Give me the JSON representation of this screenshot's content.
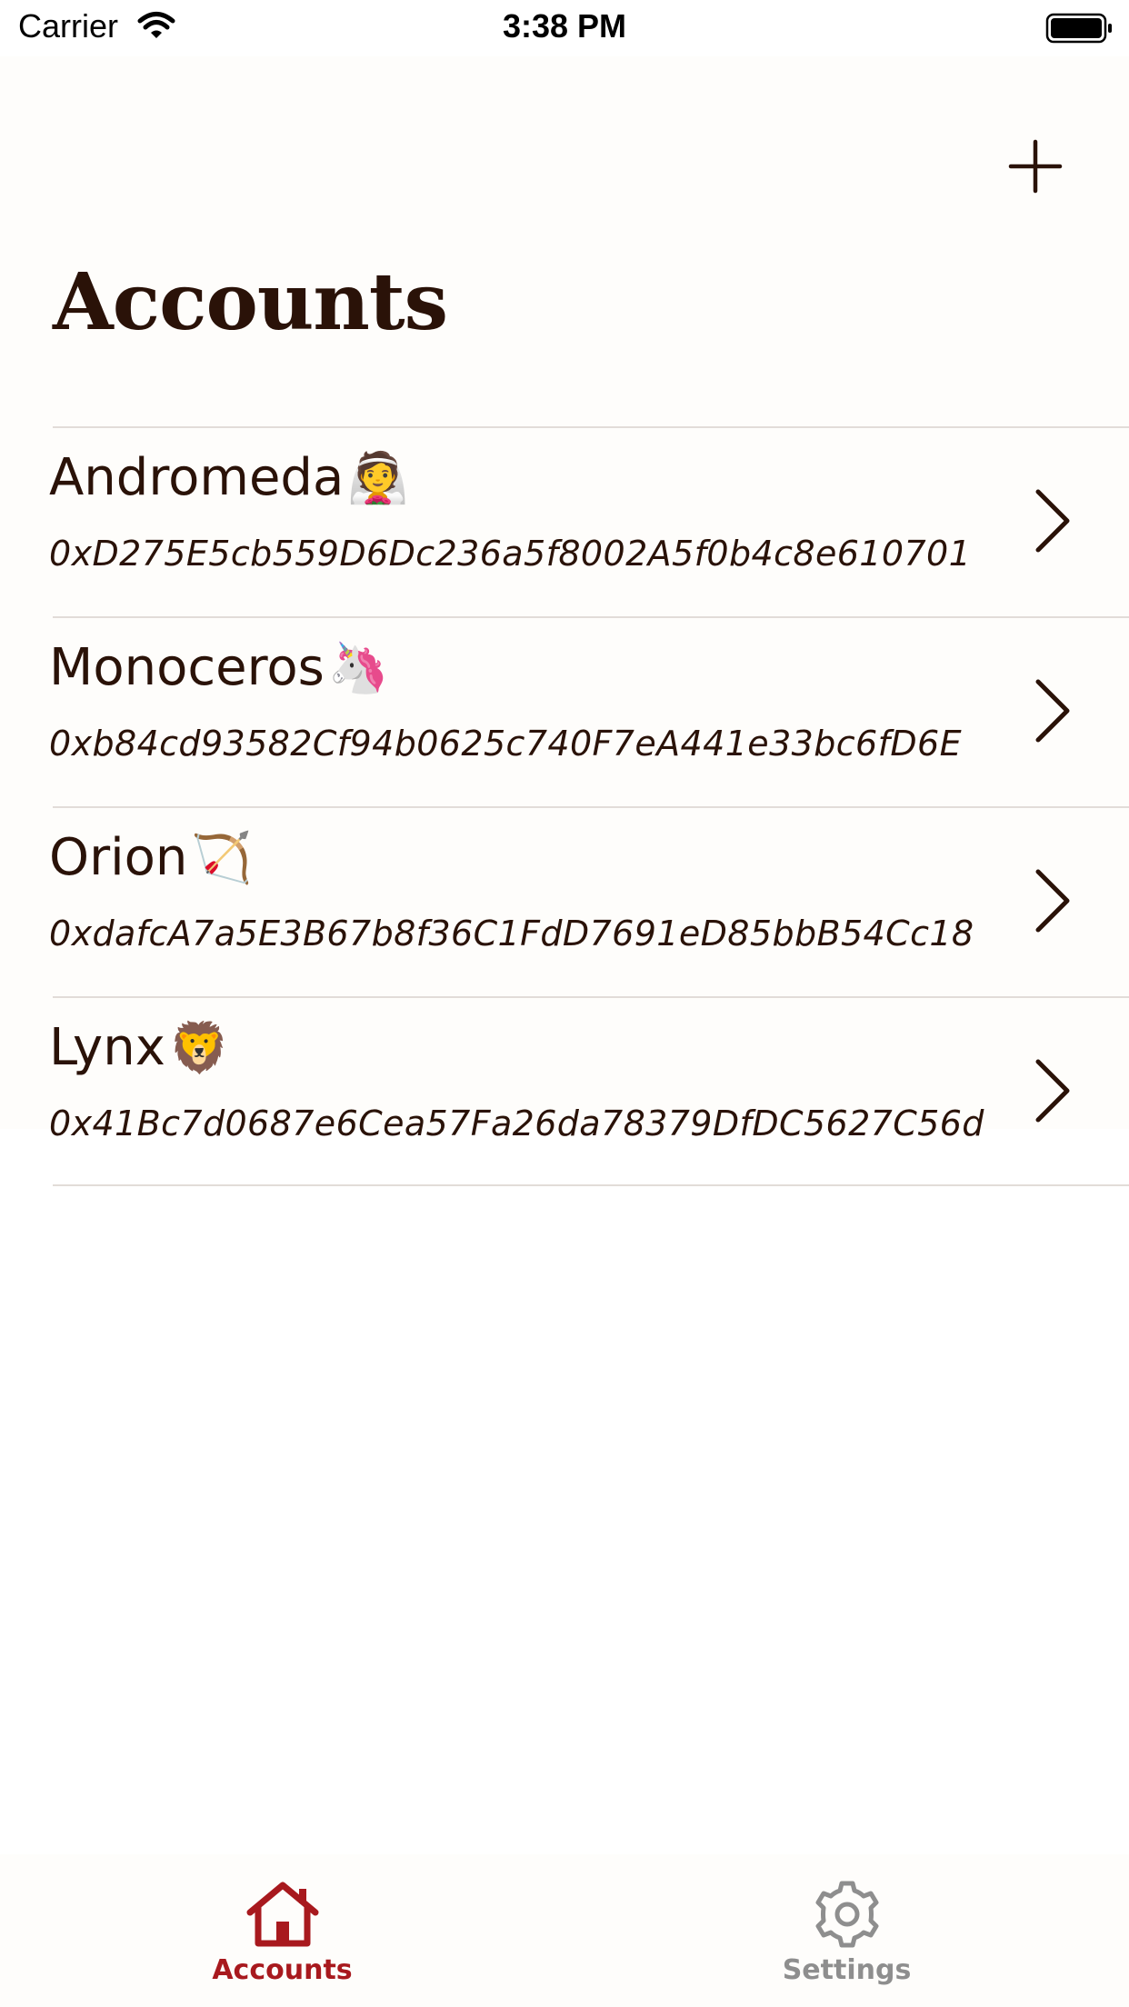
{
  "status_bar": {
    "carrier": "Carrier",
    "time": "3:38 PM"
  },
  "header": {
    "title": "Accounts",
    "add_icon": "plus-icon"
  },
  "accounts": [
    {
      "name": "Andromeda",
      "emoji": "👰",
      "address": "0xD275E5cb559D6Dc236a5f8002A5f0b4c8e610701"
    },
    {
      "name": "Monoceros",
      "emoji": "🦄",
      "address": "0xb84cd93582Cf94b0625c740F7eA441e33bc6fD6E"
    },
    {
      "name": "Orion",
      "emoji": "🏹",
      "address": "0xdafcA7a5E3B67b8f36C1FdD7691eD85bbB54Cc18"
    },
    {
      "name": "Lynx",
      "emoji": "🦁",
      "address": "0x41Bc7d0687e6Cea57Fa26da78379DfDC5627C56d"
    }
  ],
  "tab_bar": {
    "tabs": [
      {
        "label": "Accounts",
        "icon": "home-icon",
        "active": true
      },
      {
        "label": "Settings",
        "icon": "gear-icon",
        "active": false
      }
    ]
  },
  "colors": {
    "text": "#2a1208",
    "accent": "#a8191e",
    "inactive": "#8e8e8e",
    "background": "#fefdfb"
  }
}
